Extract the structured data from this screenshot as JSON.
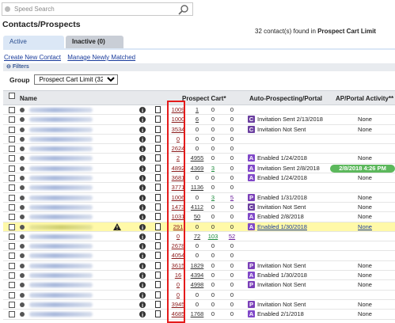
{
  "search": {
    "placeholder": "Speed Search"
  },
  "page_title": "Contacts/Prospects",
  "found_text": "32 contact(s) found in",
  "found_group": "Prospect Cart Limit",
  "tabs": {
    "active": "Active",
    "inactive": "Inactive (0)"
  },
  "links": {
    "create": "Create New Contact",
    "manage": "Manage Newly Matched"
  },
  "filters": {
    "label": "Filters",
    "group_label": "Group",
    "group_value": "Prospect Cart Limit (32)"
  },
  "columns": {
    "name": "Name",
    "cart": "Prospect Cart*",
    "auto": "Auto-Prospecting/Portal",
    "activity": "AP/Portal Activity**"
  },
  "rows": [
    {
      "c1": "1009",
      "c2": "1",
      "c3": "0",
      "c4": "0",
      "badge": "",
      "status": "",
      "activity": ""
    },
    {
      "c1": "1000",
      "c2": "6",
      "c3": "0",
      "c4": "0",
      "badge": "C",
      "status": "Invitation Sent 2/13/2018",
      "activity": "None"
    },
    {
      "c1": "3534",
      "c2": "0",
      "c3": "0",
      "c4": "0",
      "badge": "C",
      "status": "Invitation Not Sent",
      "activity": "None"
    },
    {
      "c1": "0",
      "c2": "0",
      "c3": "0",
      "c4": "0",
      "badge": "",
      "status": "",
      "activity": ""
    },
    {
      "c1": "2624",
      "c2": "0",
      "c3": "0",
      "c4": "0",
      "badge": "",
      "status": "",
      "activity": ""
    },
    {
      "c1": "2",
      "c2": "4955",
      "c3": "0",
      "c4": "0",
      "badge": "A",
      "status": "Enabled 1/24/2018",
      "activity": "None"
    },
    {
      "c1": "4892",
      "c2": "4369",
      "c3": "3",
      "c4": "0",
      "badge": "A",
      "status": "Invitation Sent 2/8/2018",
      "activity": "2/8/2018 4:26 PM",
      "pill": true
    },
    {
      "c1": "3681",
      "c2": "0",
      "c3": "0",
      "c4": "0",
      "badge": "A",
      "status": "Enabled 1/24/2018",
      "activity": "None"
    },
    {
      "c1": "3771",
      "c2": "1136",
      "c3": "0",
      "c4": "0",
      "badge": "",
      "status": "",
      "activity": ""
    },
    {
      "c1": "1006",
      "c2": "0",
      "c3": "3",
      "c4": "5",
      "badge": "P",
      "status": "Enabled 1/31/2018",
      "activity": "None"
    },
    {
      "c1": "1473",
      "c2": "4112",
      "c3": "0",
      "c4": "0",
      "badge": "C",
      "status": "Invitation Not Sent",
      "activity": "None"
    },
    {
      "c1": "1031",
      "c2": "50",
      "c3": "0",
      "c4": "0",
      "badge": "A",
      "status": "Enabled 2/8/2018",
      "activity": "None"
    },
    {
      "c1": "291",
      "c2": "0",
      "c3": "0",
      "c4": "0",
      "badge": "A",
      "status": "Enabled 1/30/2018",
      "activity": "None",
      "hl": true,
      "warn": true
    },
    {
      "c1": "0",
      "c2": "72",
      "c3": "103",
      "c4": "52",
      "badge": "",
      "status": "",
      "activity": ""
    },
    {
      "c1": "2678",
      "c2": "0",
      "c3": "0",
      "c4": "0",
      "badge": "",
      "status": "",
      "activity": ""
    },
    {
      "c1": "4054",
      "c2": "0",
      "c3": "0",
      "c4": "0",
      "badge": "",
      "status": "",
      "activity": ""
    },
    {
      "c1": "3615",
      "c2": "1829",
      "c3": "0",
      "c4": "0",
      "badge": "P",
      "status": "Invitation Not Sent",
      "activity": "None"
    },
    {
      "c1": "16",
      "c2": "4394",
      "c3": "0",
      "c4": "0",
      "badge": "A",
      "status": "Enabled 1/30/2018",
      "activity": "None"
    },
    {
      "c1": "0",
      "c2": "4998",
      "c3": "0",
      "c4": "0",
      "badge": "P",
      "status": "Invitation Not Sent",
      "activity": "None"
    },
    {
      "c1": "0",
      "c2": "0",
      "c3": "0",
      "c4": "0",
      "badge": "",
      "status": "",
      "activity": ""
    },
    {
      "c1": "3945",
      "c2": "0",
      "c3": "0",
      "c4": "0",
      "badge": "P",
      "status": "Invitation Not Sent",
      "activity": "None"
    },
    {
      "c1": "4685",
      "c2": "1768",
      "c3": "0",
      "c4": "0",
      "badge": "A",
      "status": "Enabled 2/1/2018",
      "activity": "None"
    }
  ],
  "colors": {
    "highlight": "#fff9a8",
    "badge_purple": "#6b3fa0",
    "pill_green": "#5cb85c",
    "red_box": "#e41b1b"
  }
}
